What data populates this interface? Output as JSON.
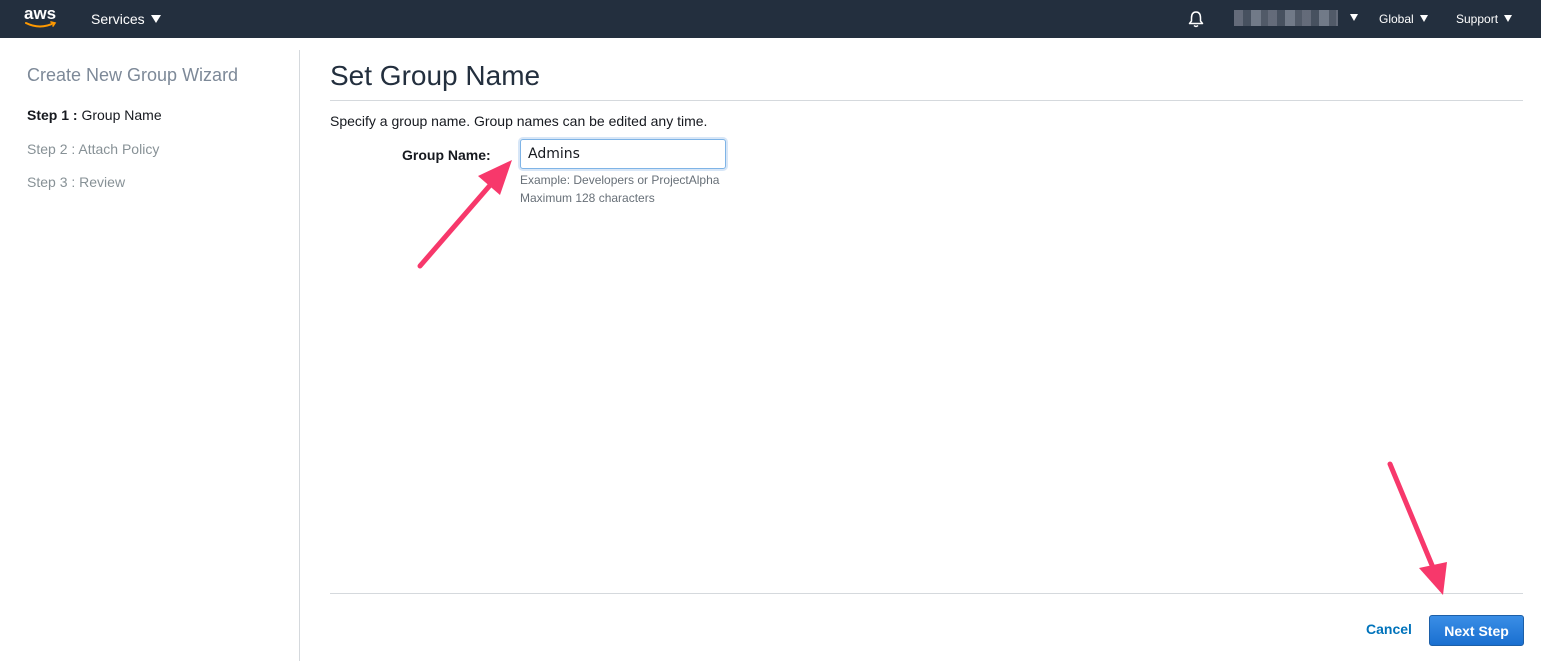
{
  "topbar": {
    "logo_text": "aws",
    "services_label": "Services",
    "region_label": "Global",
    "support_label": "Support",
    "bell_icon": "bell-icon",
    "account_name_redacted": true
  },
  "wizard": {
    "title": "Create New Group Wizard",
    "steps": [
      {
        "prefix": "Step 1 :",
        "label": "Group Name",
        "active": true
      },
      {
        "prefix": "Step 2 :",
        "label": "Attach Policy",
        "active": false
      },
      {
        "prefix": "Step 3 :",
        "label": "Review",
        "active": false
      }
    ]
  },
  "main": {
    "title": "Set Group Name",
    "intro": "Specify a group name. Group names can be edited any time.",
    "field_label": "Group Name:",
    "field_value": "Admins",
    "hint_example": "Example: Developers or ProjectAlpha",
    "hint_max": "Maximum 128 characters"
  },
  "footer": {
    "cancel_label": "Cancel",
    "next_label": "Next Step"
  },
  "colors": {
    "topbar_bg": "#232f3e",
    "link": "#0073bb",
    "primary_button": "#1a6fd0",
    "annotation_arrow": "#f7386b"
  }
}
